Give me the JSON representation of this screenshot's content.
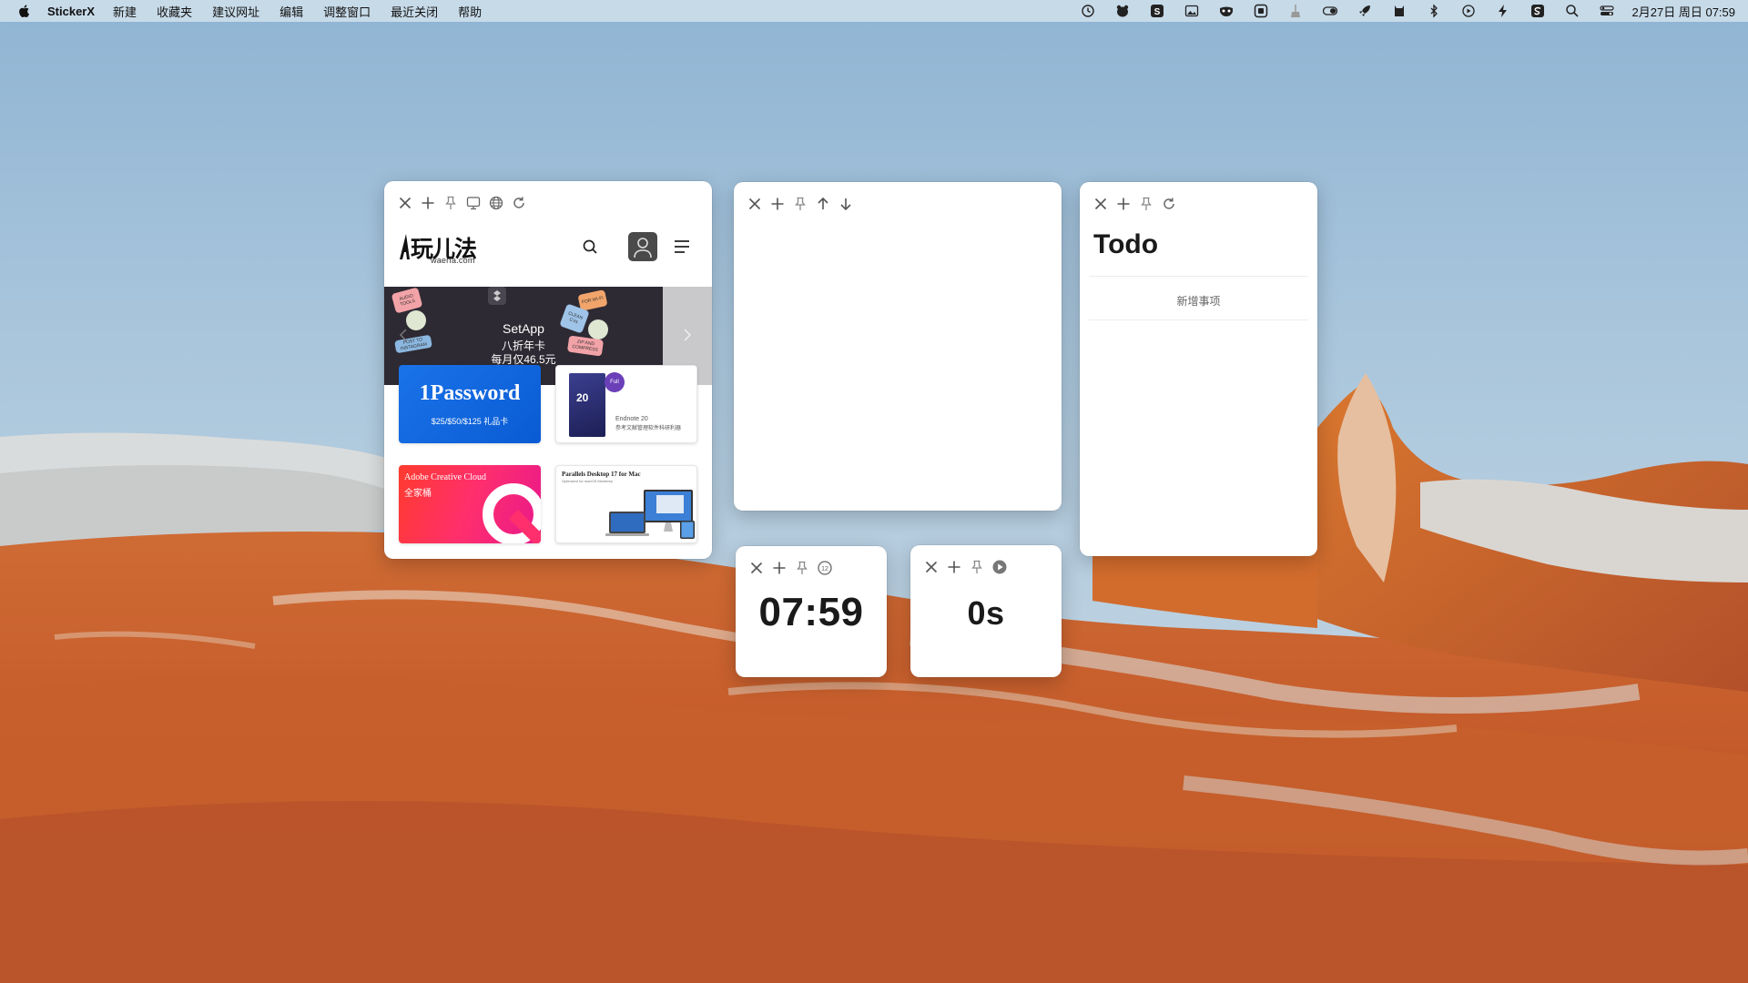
{
  "menubar": {
    "app_name": "StickerX",
    "items": [
      "新建",
      "收藏夹",
      "建议网址",
      "编辑",
      "调整窗口",
      "最近关闭",
      "帮助"
    ],
    "status_icons": [
      "history-icon",
      "bear-icon",
      "s-app-icon",
      "image-icon",
      "mask-icon",
      "square-app-icon",
      "broom-icon",
      "toggle-icon",
      "rocket-icon",
      "cat-icon",
      "bluetooth-icon",
      "play-circle-icon",
      "bolt-icon",
      "s-box-icon",
      "search-icon",
      "control-center-icon"
    ],
    "clock": "2月27日 周日  07:59"
  },
  "web_sticker": {
    "toolbar_icons": [
      "close-icon",
      "add-icon",
      "pin-icon",
      "display-icon",
      "globe-icon",
      "reload-icon"
    ],
    "site": {
      "logo_text": "玩儿法",
      "logo_sub": "waerfa.com"
    },
    "banner": {
      "title": "SetApp",
      "line1": "八折年卡",
      "line2": "每月仅46.5元",
      "tags": [
        "FOR WI-FI",
        "AUDIO TOOLS",
        "POST TO INSTAGRAM",
        "CLEAN CVs",
        "ZIP AND COMPRESS"
      ]
    },
    "cards": {
      "onepassword": {
        "title": "1Password",
        "subtitle": "$25/$50/$125 礼品卡"
      },
      "endnote": {
        "box_number": "20",
        "badge": "Full",
        "line1": "Endnote 20",
        "line2": "参考文献管理软件科研利器"
      },
      "adobe": {
        "title": "Adobe Creative Cloud",
        "subtitle": "全家桶"
      },
      "parallels": {
        "title": "Parallels Desktop 17 for Mac",
        "subtitle": "Optimized for macOS Monterey"
      }
    }
  },
  "empty_sticker": {
    "toolbar_icons": [
      "close-icon",
      "add-icon",
      "pin-icon",
      "arrow-up-icon",
      "arrow-down-icon"
    ]
  },
  "todo_sticker": {
    "toolbar_icons": [
      "close-icon",
      "add-icon",
      "pin-icon",
      "reload-icon"
    ],
    "title": "Todo",
    "add_item": "新增事项"
  },
  "clock_sticker": {
    "toolbar_icons": [
      "close-icon",
      "add-icon",
      "pin-icon",
      "clock-12-icon"
    ],
    "time": "07:59"
  },
  "timer_sticker": {
    "toolbar_icons": [
      "close-icon",
      "add-icon",
      "pin-icon",
      "play-icon"
    ],
    "value": "0s"
  },
  "colors": {
    "menubar_bg": "#d6e4ee",
    "sky_top": "#8fb6d6",
    "sky_bottom": "#c9dbe8",
    "rock_orange": "#c4582a",
    "rock_white": "#d8d8d6",
    "onepassword_blue": "#1a73e8",
    "endnote_purple": "#6b3fb8",
    "adobe_red": "#ff3b2e"
  }
}
